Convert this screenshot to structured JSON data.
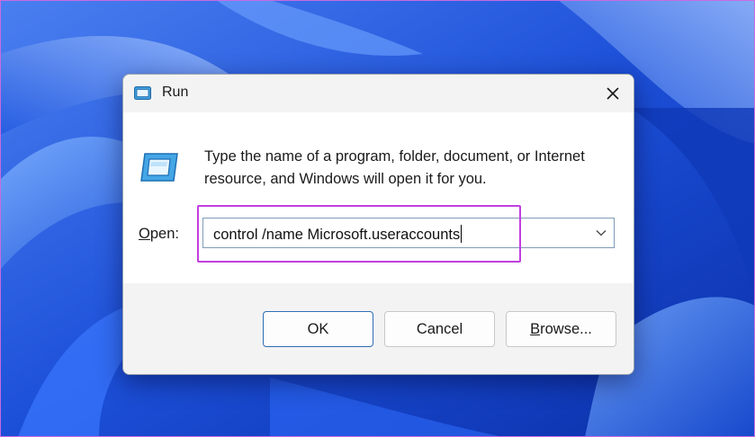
{
  "window": {
    "title": "Run",
    "close_icon": "close-icon"
  },
  "body": {
    "description": "Type the name of a program, folder, document, or Internet resource, and Windows will open it for you.",
    "open_label": "Open:",
    "input_value": "control /name Microsoft.useraccounts"
  },
  "buttons": {
    "ok": "OK",
    "cancel": "Cancel",
    "browse": "Browse..."
  },
  "colors": {
    "highlight": "#c23ee0",
    "wallpaper": "#1e5fe0"
  }
}
